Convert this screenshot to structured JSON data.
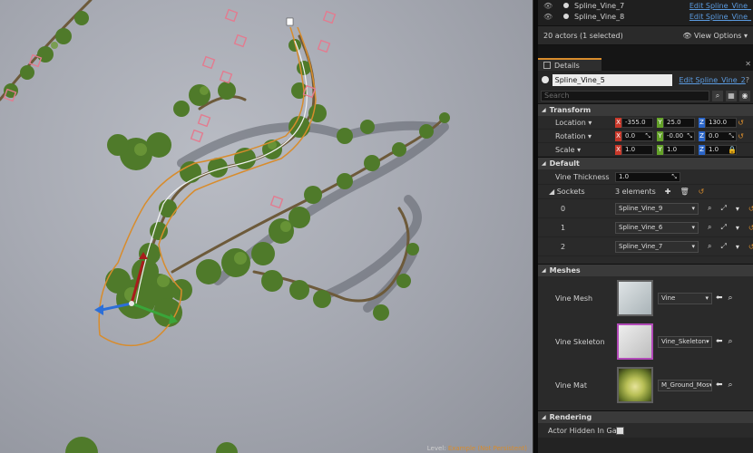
{
  "viewport": {
    "status_label": "Level:",
    "status_value": "Example (Not Persistent)"
  },
  "outliner": {
    "rows": [
      {
        "name": "Spline_Vine_7",
        "edit": "Edit Spline_Vine_"
      },
      {
        "name": "Spline_Vine_8",
        "edit": "Edit Spline_Vine_"
      }
    ],
    "actor_count": "20 actors (1 selected)",
    "view_options": "View Options"
  },
  "details": {
    "tab_label": "Details",
    "actor_name": "Spline_Vine_5",
    "edit_link": "Edit Spline_Vine_2",
    "search_placeholder": "Search",
    "transform": {
      "title": "Transform",
      "location": {
        "label": "Location",
        "x": "-355.0",
        "y": "25.0",
        "z": "130.0"
      },
      "rotation": {
        "label": "Rotation",
        "x": "0.0",
        "y": "-0.00",
        "z": "0.0"
      },
      "scale": {
        "label": "Scale",
        "x": "1.0",
        "y": "1.0",
        "z": "1.0"
      }
    },
    "default": {
      "title": "Default",
      "vine_thickness_label": "Vine Thickness",
      "vine_thickness_value": "1.0",
      "sockets_label": "Sockets",
      "sockets_count": "3 elements",
      "sockets": [
        {
          "index": "0",
          "value": "Spline_Vine_9"
        },
        {
          "index": "1",
          "value": "Spline_Vine_6"
        },
        {
          "index": "2",
          "value": "Spline_Vine_7"
        }
      ]
    },
    "meshes": {
      "title": "Meshes",
      "vine_mesh_label": "Vine Mesh",
      "vine_mesh_value": "Vine",
      "vine_skeleton_label": "Vine Skeleton",
      "vine_skeleton_value": "Vine_Skeleton",
      "vine_mat_label": "Vine Mat",
      "vine_mat_value": "M_Ground_Mos"
    },
    "rendering": {
      "title": "Rendering",
      "actor_hidden_label": "Actor Hidden In Gar"
    }
  },
  "colors": {
    "accent_orange": "#d88c2c",
    "link_blue": "#5b9be0",
    "axis_x": "#c9382a",
    "axis_y": "#64a229",
    "axis_z": "#2b66c9",
    "foliage_green": "#4f7a2a"
  }
}
